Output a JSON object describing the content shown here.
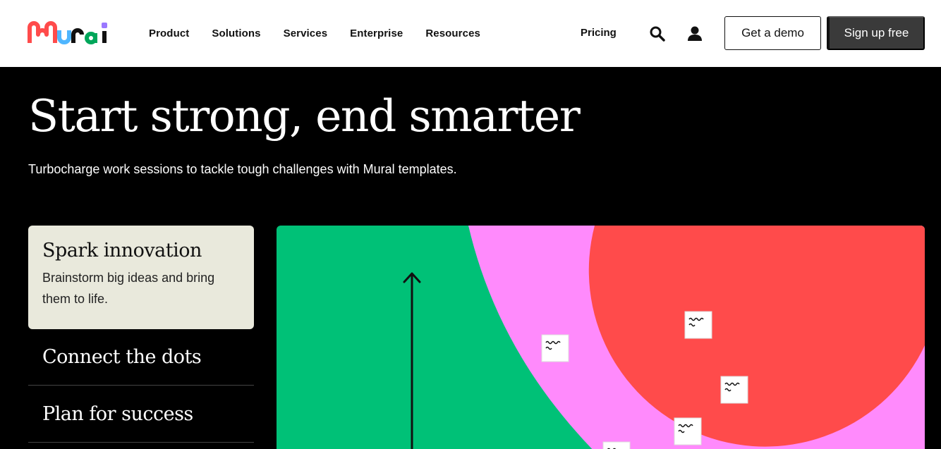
{
  "brand": {
    "name": "Mural",
    "colors": {
      "red": "#ff4b4b",
      "purple": "#9a78ff",
      "blue": "#4fb6ff",
      "green": "#00c177",
      "pink": "#ff8afc"
    }
  },
  "nav": {
    "links": [
      "Product",
      "Solutions",
      "Services",
      "Enterprise",
      "Resources"
    ],
    "pricing": "Pricing",
    "search_icon": "search-icon",
    "user_icon": "user-icon",
    "demo_label": "Get a demo",
    "signup_label": "Sign up free"
  },
  "hero": {
    "title": "Start strong, end smarter",
    "subtitle": "Turbocharge work sessions to tackle tough challenges with Mural templates."
  },
  "use_cases": {
    "active": {
      "title": "Spark innovation",
      "description": "Brainstorm big ideas and bring them to life."
    },
    "items": [
      "Connect the dots",
      "Plan for success"
    ]
  },
  "illustration": {
    "colors": {
      "green": "#00c177",
      "pink": "#ff8afc",
      "red": "#ff4b4b",
      "note": "#ffffff"
    }
  }
}
